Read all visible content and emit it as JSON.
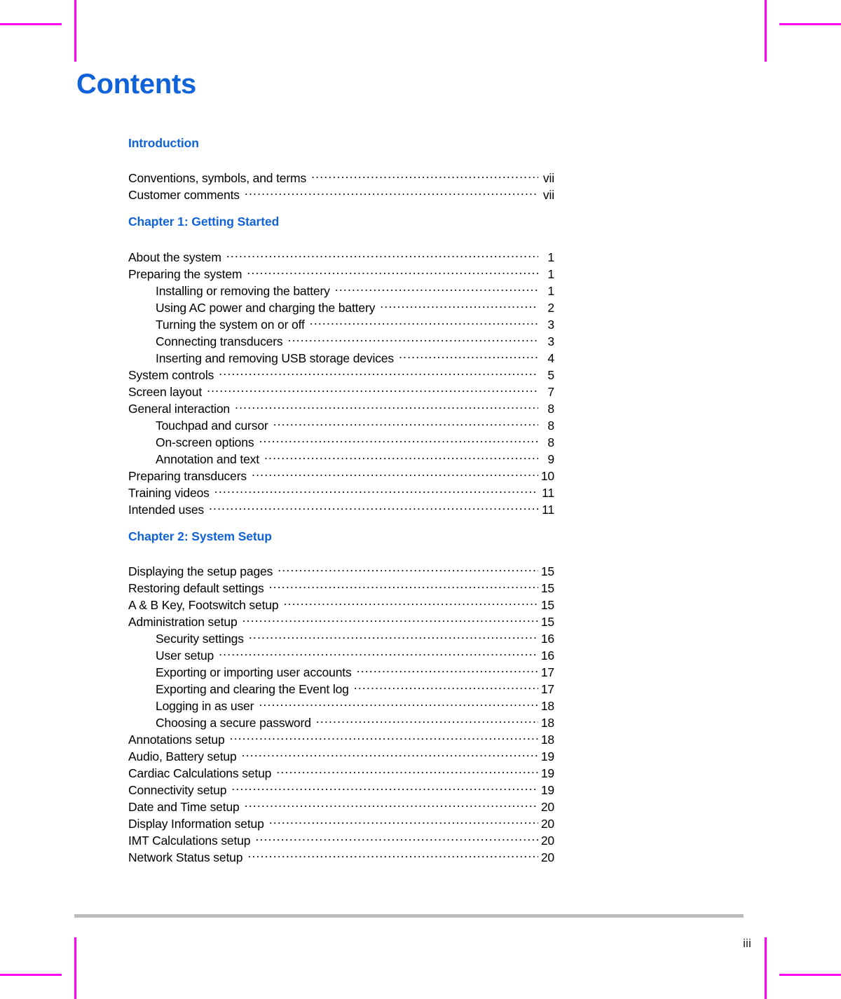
{
  "document": {
    "title": "Contents",
    "folio": "iii",
    "title_color": "#0f62d8",
    "heading_color": "#0f62d8",
    "text_color": "#000000",
    "rule_color": "#bcbcbc",
    "crop_mark_color": "#ff00f2"
  },
  "sections": [
    {
      "heading": "Introduction",
      "entries": [
        {
          "level": 1,
          "title": "Conventions, symbols, and terms",
          "page": "vii"
        },
        {
          "level": 1,
          "title": "Customer comments",
          "page": "vii"
        }
      ]
    },
    {
      "heading": "Chapter 1: Getting Started",
      "entries": [
        {
          "level": 1,
          "title": "About the system",
          "page": "1"
        },
        {
          "level": 1,
          "title": "Preparing the system",
          "page": "1"
        },
        {
          "level": 2,
          "title": "Installing or removing the battery",
          "page": "1"
        },
        {
          "level": 2,
          "title": "Using AC power and charging the battery",
          "page": "2"
        },
        {
          "level": 2,
          "title": "Turning the system on or off",
          "page": "3"
        },
        {
          "level": 2,
          "title": "Connecting transducers",
          "page": "3"
        },
        {
          "level": 2,
          "title": "Inserting and removing USB storage devices",
          "page": "4"
        },
        {
          "level": 1,
          "title": "System controls",
          "page": "5"
        },
        {
          "level": 1,
          "title": "Screen layout",
          "page": "7"
        },
        {
          "level": 1,
          "title": "General interaction",
          "page": "8"
        },
        {
          "level": 2,
          "title": "Touchpad and cursor",
          "page": "8"
        },
        {
          "level": 2,
          "title": "On-screen options",
          "page": "8"
        },
        {
          "level": 2,
          "title": "Annotation and text",
          "page": "9"
        },
        {
          "level": 1,
          "title": "Preparing transducers",
          "page": "10"
        },
        {
          "level": 1,
          "title": "Training videos",
          "page": "11"
        },
        {
          "level": 1,
          "title": "Intended uses",
          "page": "11"
        }
      ]
    },
    {
      "heading": "Chapter 2: System Setup",
      "entries": [
        {
          "level": 1,
          "title": "Displaying the setup pages",
          "page": "15"
        },
        {
          "level": 1,
          "title": "Restoring default settings",
          "page": "15"
        },
        {
          "level": 1,
          "title": "A & B Key, Footswitch setup",
          "page": "15"
        },
        {
          "level": 1,
          "title": "Administration setup",
          "page": "15"
        },
        {
          "level": 2,
          "title": "Security settings",
          "page": "16"
        },
        {
          "level": 2,
          "title": "User setup",
          "page": "16"
        },
        {
          "level": 2,
          "title": "Exporting or importing user accounts",
          "page": "17"
        },
        {
          "level": 2,
          "title": "Exporting and clearing the Event log",
          "page": "17"
        },
        {
          "level": 2,
          "title": "Logging in as user",
          "page": "18"
        },
        {
          "level": 2,
          "title": "Choosing a secure password",
          "page": "18"
        },
        {
          "level": 1,
          "title": "Annotations setup",
          "page": "18"
        },
        {
          "level": 1,
          "title": "Audio, Battery setup",
          "page": "19"
        },
        {
          "level": 1,
          "title": "Cardiac Calculations setup",
          "page": "19"
        },
        {
          "level": 1,
          "title": "Connectivity setup",
          "page": "19"
        },
        {
          "level": 1,
          "title": "Date and Time setup",
          "page": "20"
        },
        {
          "level": 1,
          "title": "Display Information setup",
          "page": "20"
        },
        {
          "level": 1,
          "title": "IMT Calculations setup",
          "page": "20"
        },
        {
          "level": 1,
          "title": "Network Status setup",
          "page": "20"
        }
      ]
    }
  ]
}
